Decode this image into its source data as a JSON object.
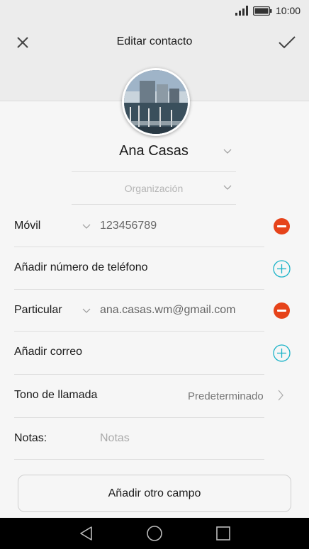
{
  "status_bar": {
    "time": "10:00",
    "icons": [
      "signal-icon",
      "battery-icon"
    ]
  },
  "header": {
    "title": "Editar contacto",
    "close_icon": "close-icon",
    "save_icon": "checkmark-icon"
  },
  "contact": {
    "name": "Ana Casas",
    "organization_placeholder": "Organización",
    "photo": "contact-photo"
  },
  "fields": {
    "phone": {
      "type_label": "Móvil",
      "value": "123456789"
    },
    "add_phone_label": "Añadir número de teléfono",
    "email": {
      "type_label": "Particular",
      "value": "ana.casas.wm@gmail.com"
    },
    "add_email_label": "Añadir correo",
    "ringtone": {
      "label": "Tono de llamada",
      "value": "Predeterminado"
    },
    "notes": {
      "label": "Notas:",
      "placeholder": "Notas"
    }
  },
  "add_field_button": "Añadir otro campo",
  "colors": {
    "remove": "#e6431a",
    "add": "#1ab3c8",
    "background": "#f6f6f6"
  },
  "nav_bar": {
    "icons": [
      "back-icon",
      "home-icon",
      "recents-icon"
    ]
  }
}
